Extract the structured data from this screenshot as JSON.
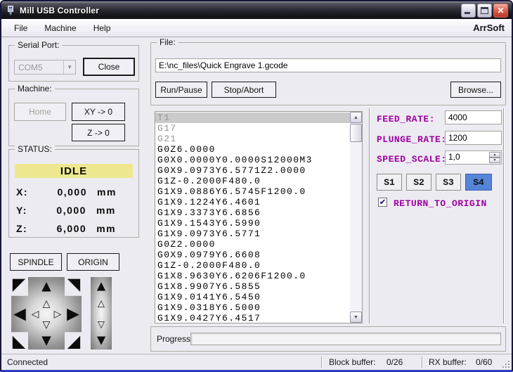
{
  "window": {
    "title": "Mill USB Controller",
    "brand": "ArrSoft"
  },
  "menu": {
    "items": [
      "File",
      "Machine",
      "Help"
    ]
  },
  "serial": {
    "group_label": "Serial Port:",
    "port_value": "COM5",
    "close_button": "Close"
  },
  "machine": {
    "group_label": "Machine:",
    "home_button": "Home",
    "xy_zero_button": "XY -> 0",
    "z_zero_button": "Z -> 0"
  },
  "status": {
    "group_label": "STATUS:",
    "state": "IDLE",
    "axes": [
      {
        "label": "X:",
        "value": "0,000",
        "unit": "mm"
      },
      {
        "label": "Y:",
        "value": "0,000",
        "unit": "mm"
      },
      {
        "label": "Z:",
        "value": "6,000",
        "unit": "mm"
      }
    ]
  },
  "jog": {
    "spindle_button": "SPINDLE",
    "origin_button": "ORIGIN"
  },
  "file": {
    "group_label": "File:",
    "path": "E:\\nc_files\\Quick Engrave 1.gcode",
    "run_button": "Run/Pause",
    "stop_button": "Stop/Abort",
    "browse_button": "Browse..."
  },
  "gcode": {
    "lines": [
      "T1",
      "G17",
      "G21",
      "G0Z6.0000",
      "G0X0.0000Y0.0000S12000M3",
      "G0X9.0973Y6.5771Z2.0000",
      "G1Z-0.2000F480.0",
      "G1X9.0886Y6.5745F1200.0",
      "G1X9.1224Y6.4601",
      "G1X9.3373Y6.6856",
      "G1X9.1543Y6.5990",
      "G1X9.0973Y6.5771",
      "G0Z2.0000",
      "G0X9.0979Y6.6608",
      "G1Z-0.2000F480.0",
      "G1X8.9630Y6.6206F1200.0",
      "G1X8.9907Y6.5855",
      "G1X9.0141Y6.5450",
      "G1X9.0318Y6.5000",
      "G1X9.0427Y6.4517"
    ]
  },
  "params": {
    "feed_rate_label": "FEED_RATE:",
    "feed_rate": "4000",
    "plunge_rate_label": "PLUNGE_RATE:",
    "plunge_rate": "1200",
    "speed_scale_label": "SPEED_SCALE:",
    "speed_scale": "1,0",
    "s_buttons": [
      "S1",
      "S2",
      "S3",
      "S4"
    ],
    "active_s": "S4",
    "return_label": "RETURN_TO_ORIGIN",
    "return_checked": true
  },
  "progress": {
    "label": "Progress:"
  },
  "statusbar": {
    "connection": "Connected",
    "block_buffer_label": "Block buffer:",
    "block_buffer_value": "0/26",
    "rx_buffer_label": "RX buffer:",
    "rx_buffer_value": "0/60"
  },
  "icons": {
    "close_glyph": "✕",
    "combo_arrow": "▼",
    "check": "✔",
    "spin_up": "▲",
    "spin_down": "▼",
    "scroll_up": "▲",
    "scroll_down": "▼",
    "up": "▲",
    "down": "▼",
    "left": "◀",
    "right": "▶",
    "up_small": "△",
    "down_small": "▽",
    "left_small": "◁",
    "right_small": "▷",
    "up_left": "◤",
    "up_right": "◥",
    "down_left": "◣",
    "down_right": "◢"
  },
  "colors": {
    "idle_bg": "#EDE88F",
    "label_purple": "#A000A0",
    "s_active_blue": "#5585D8",
    "titlebar_dark": "#1c1c24",
    "close_red": "#C74431",
    "face": "#ECEBF2"
  }
}
